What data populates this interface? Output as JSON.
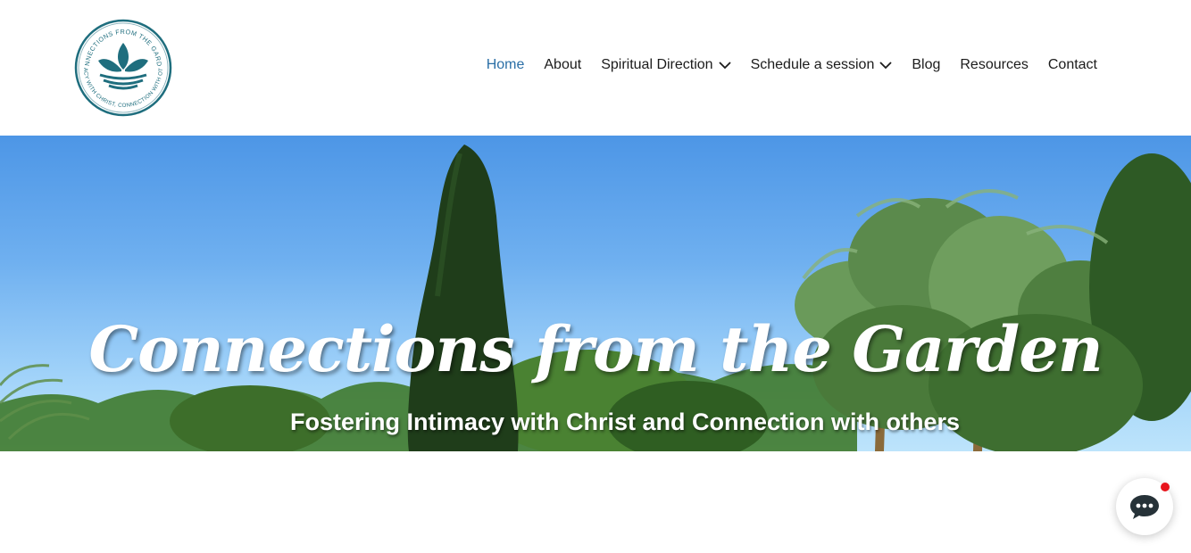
{
  "header": {
    "logo": {
      "icon": "leaf-in-circle-logo",
      "top_text": "CONNECTIONS FROM THE GARDEN",
      "bottom_text": "INTIMACY WITH CHRIST, CONNECTION WITH OTHERS",
      "color": "#1f6e7e"
    },
    "nav": [
      {
        "label": "Home",
        "active": true
      },
      {
        "label": "About"
      },
      {
        "label": "Spiritual Direction",
        "has_dropdown": true
      },
      {
        "label": "Schedule a session",
        "has_dropdown": true
      },
      {
        "label": "Blog"
      },
      {
        "label": "Resources"
      },
      {
        "label": "Contact"
      }
    ],
    "active_color": "#2b6fa6"
  },
  "hero": {
    "title": "Connections from the Garden",
    "subtitle": "Fostering Intimacy with Christ and Connection with others"
  },
  "chat": {
    "icon": "chat-bubble-icon",
    "notification_color": "#e8141c"
  }
}
